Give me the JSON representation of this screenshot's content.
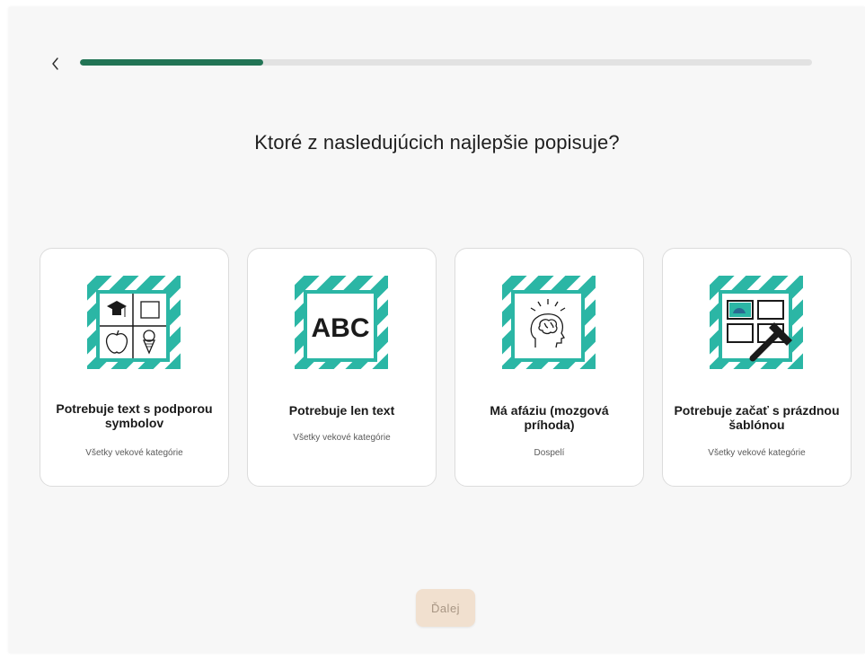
{
  "header": {
    "progress_percent": 25
  },
  "question": "Ktoré z nasledujúcich najlepšie popisuje?",
  "cards": [
    {
      "title": "Potrebuje text s podporou symbolov",
      "subtitle": "Všetky vekové kategórie",
      "icon": "symbols-grid-icon"
    },
    {
      "title": "Potrebuje len text",
      "subtitle": "Všetky vekové kategórie",
      "icon": "abc-text-icon",
      "icon_text": "ABC"
    },
    {
      "title": "Má afáziu (mozgová príhoda)",
      "subtitle": "Dospelí",
      "icon": "brain-head-icon"
    },
    {
      "title": "Potrebuje začať s prázdnou šablónou",
      "subtitle": "Všetky vekové kategórie",
      "icon": "blank-template-icon"
    }
  ],
  "next_label": "Ďalej",
  "colors": {
    "accent": "#227455",
    "teal": "#2bb6a5",
    "next_button_bg": "#f1e0cf"
  }
}
